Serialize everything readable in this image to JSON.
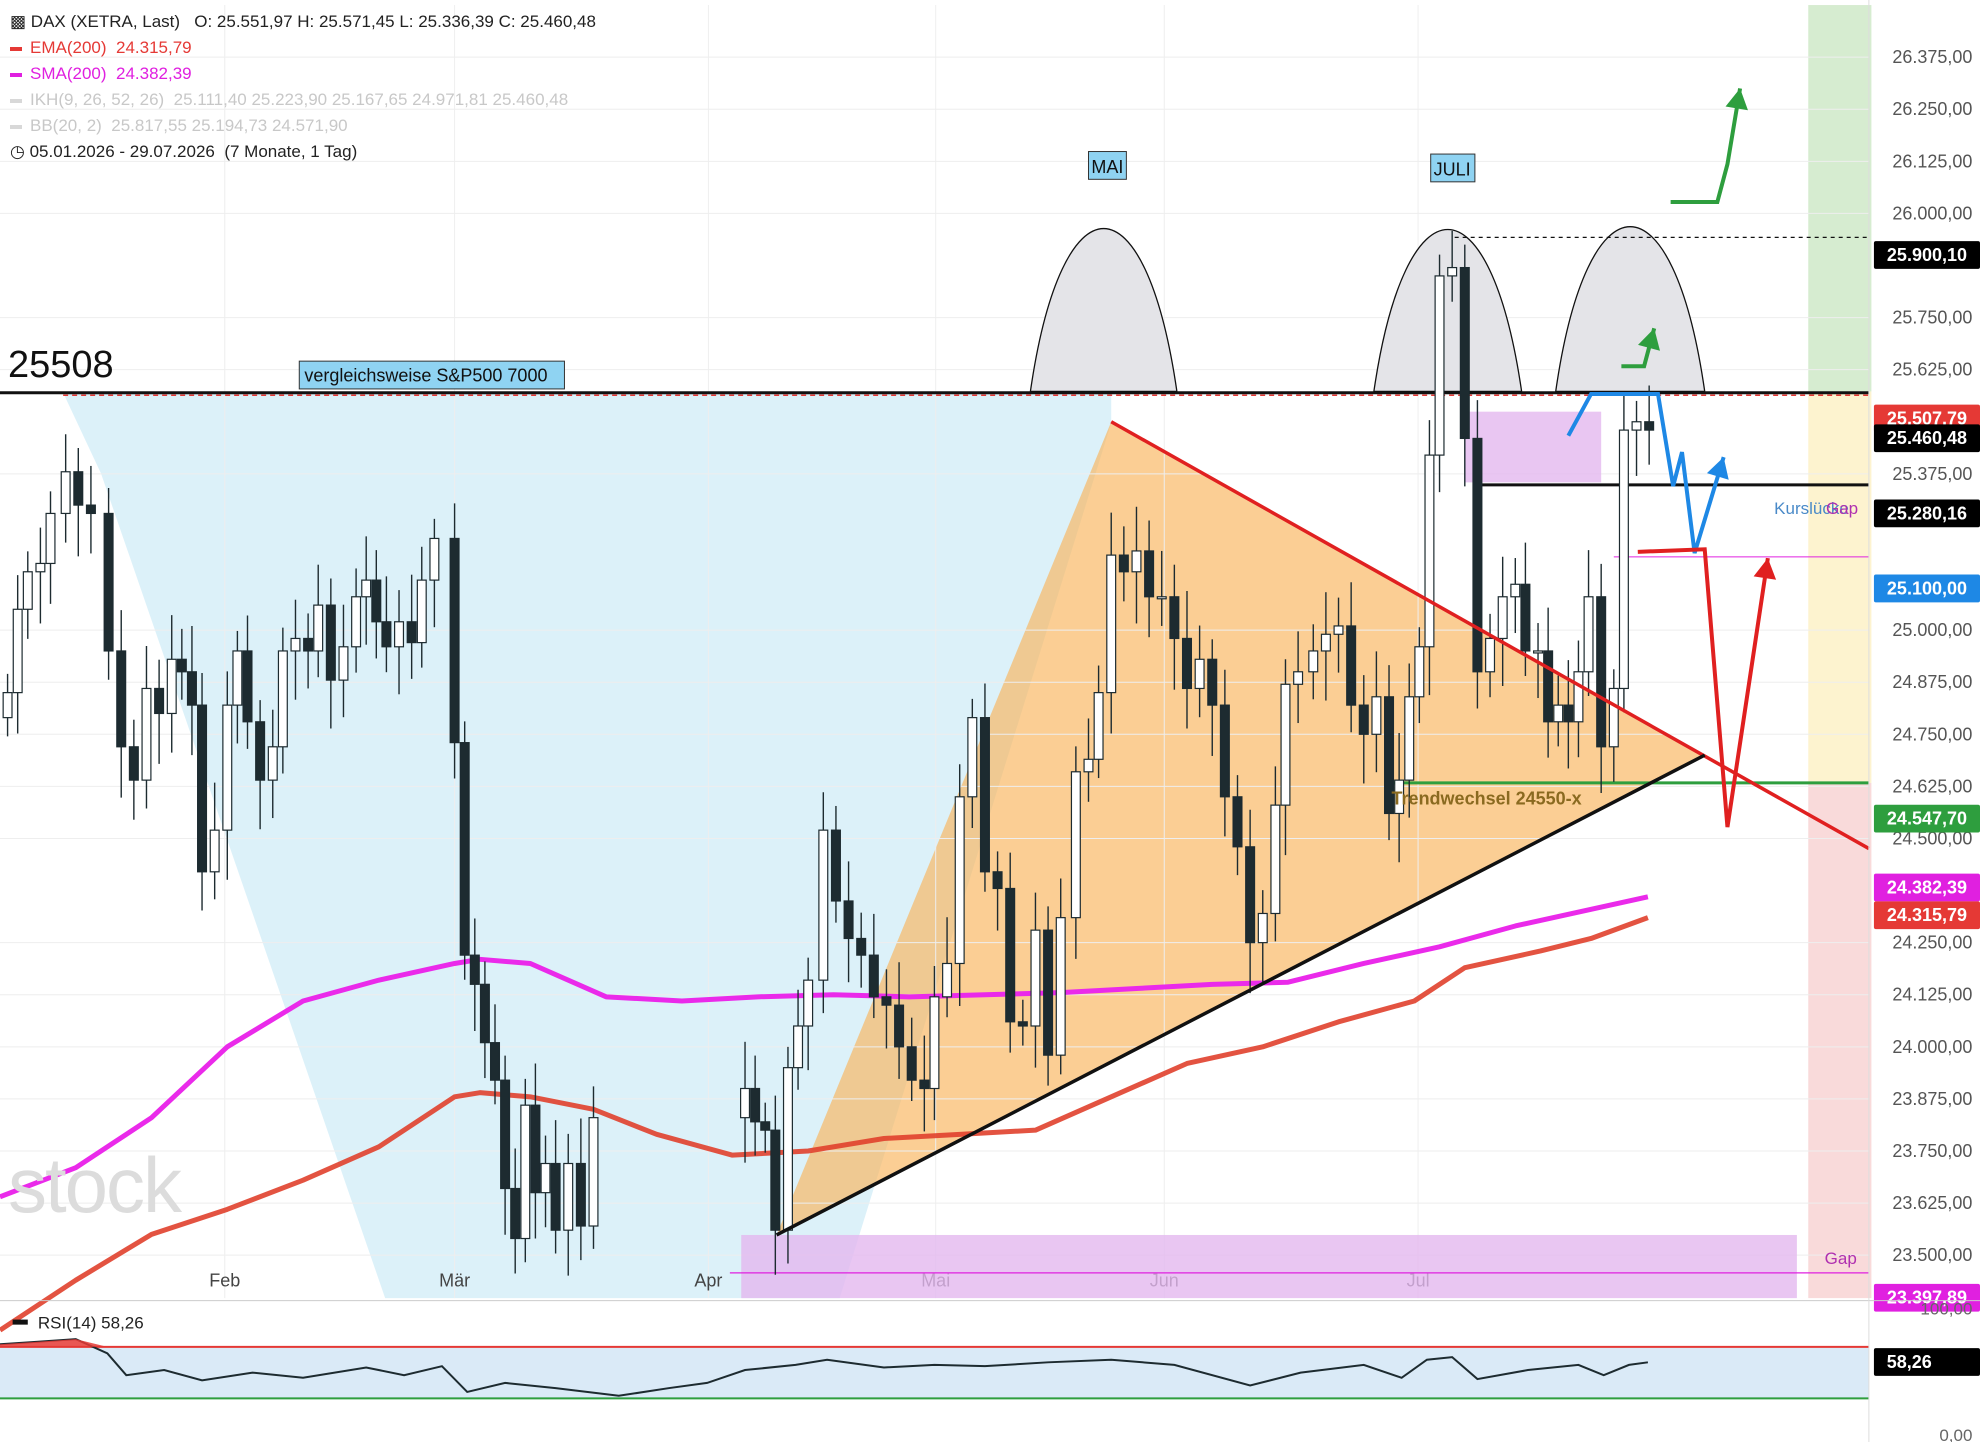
{
  "header": {
    "instrument": "DAX (XETRA, Last)",
    "ohlc": "O: 25.551,97   H: 25.571,45   L: 25.336,39   C: 25.460,48",
    "ema": {
      "label": "EMA(200)",
      "value": "24.315,79",
      "color": "#e53935"
    },
    "sma": {
      "label": "SMA(200)",
      "value": "24.382,39",
      "color": "#e020e0"
    },
    "ikh": {
      "label": "IKH(9, 26, 52, 26)",
      "values": "25.111,40   25.223,90   25.167,65   24.971,81   25.460,48"
    },
    "bb": {
      "label": "BB(20, 2)",
      "values": "25.817,55   25.194,73   24.571,90"
    },
    "range": "05.01.2026 - 29.07.2026",
    "range_note": "(7 Monate, 1 Tag)"
  },
  "level_text": "25508",
  "watermark": "stock",
  "chart_data": {
    "type": "candlestick",
    "y_axis": {
      "min": 23300,
      "max": 26500,
      "ticks": [
        "26.375,00",
        "26.250,00",
        "26.125,00",
        "26.000,00",
        "25.750,00",
        "25.625,00",
        "25.375,00",
        "25.000,00",
        "24.875,00",
        "24.750,00",
        "24.625,00",
        "24.500,00",
        "24.250,00",
        "24.125,00",
        "24.000,00",
        "23.875,00",
        "23.750,00",
        "23.625,00",
        "23.500,00"
      ],
      "tick_values": [
        26375,
        26250,
        26125,
        26000,
        25750,
        25625,
        25375,
        25000,
        24875,
        24750,
        24625,
        24500,
        24250,
        24125,
        24000,
        23875,
        23750,
        23625,
        23500
      ]
    },
    "x_axis": {
      "labels": [
        "Feb",
        "Mär",
        "Apr",
        "Mai",
        "Jun",
        "Jul"
      ]
    },
    "price_labels": [
      {
        "text": "25.900,10",
        "value": 25900.1,
        "bg": "#000000",
        "fg": "#ffffff"
      },
      {
        "text": "25.507,79",
        "value": 25507.79,
        "bg": "#e53935",
        "fg": "#ffffff"
      },
      {
        "text": "25.460,48",
        "value": 25460.48,
        "bg": "#000000",
        "fg": "#ffffff"
      },
      {
        "text": "25.280,16",
        "value": 25280.16,
        "bg": "#000000",
        "fg": "#ffffff"
      },
      {
        "text": "25.100,00",
        "value": 25100,
        "bg": "#1e88e5",
        "fg": "#ffffff"
      },
      {
        "text": "24.547,70",
        "value": 24547.7,
        "bg": "#2e9e3e",
        "fg": "#ffffff"
      },
      {
        "text": "24.382,39",
        "value": 24382.39,
        "bg": "#e020e0",
        "fg": "#ffffff"
      },
      {
        "text": "24.315,79",
        "value": 24315.79,
        "bg": "#e53935",
        "fg": "#ffffff"
      },
      {
        "text": "23.397,89",
        "value": 23397.89,
        "bg": "#e020e0",
        "fg": "#ffffff"
      }
    ],
    "annotations": {
      "sp500": "vergleichsweise S&P500 7000",
      "trend": "Trendwechsel 24550-x",
      "may_label": "MAI",
      "july_label": "JULI",
      "kurslucke": "Kurslücke",
      "gap": "Gap",
      "gap2": "Gap"
    },
    "sma200": [
      [
        0,
        23640
      ],
      [
        60,
        23710
      ],
      [
        120,
        23830
      ],
      [
        180,
        24000
      ],
      [
        240,
        24110
      ],
      [
        300,
        24160
      ],
      [
        360,
        24200
      ],
      [
        380,
        24210
      ],
      [
        420,
        24200
      ],
      [
        480,
        24120
      ],
      [
        540,
        24110
      ],
      [
        600,
        24120
      ],
      [
        660,
        24125
      ],
      [
        720,
        24120
      ],
      [
        780,
        24125
      ],
      [
        840,
        24130
      ],
      [
        900,
        24140
      ],
      [
        960,
        24150
      ],
      [
        1020,
        24155
      ],
      [
        1080,
        24200
      ],
      [
        1140,
        24240
      ],
      [
        1200,
        24290
      ],
      [
        1260,
        24330
      ],
      [
        1305,
        24360
      ]
    ],
    "ema200": [
      [
        0,
        23320
      ],
      [
        60,
        23440
      ],
      [
        120,
        23550
      ],
      [
        180,
        23610
      ],
      [
        240,
        23680
      ],
      [
        300,
        23760
      ],
      [
        360,
        23880
      ],
      [
        380,
        23890
      ],
      [
        420,
        23880
      ],
      [
        470,
        23850
      ],
      [
        520,
        23790
      ],
      [
        580,
        23740
      ],
      [
        640,
        23750
      ],
      [
        700,
        23780
      ],
      [
        760,
        23790
      ],
      [
        820,
        23800
      ],
      [
        880,
        23880
      ],
      [
        940,
        23960
      ],
      [
        1000,
        24000
      ],
      [
        1060,
        24060
      ],
      [
        1120,
        24110
      ],
      [
        1160,
        24190
      ],
      [
        1220,
        24230
      ],
      [
        1260,
        24260
      ],
      [
        1305,
        24310
      ]
    ],
    "rsi": {
      "label": "RSI(14)",
      "value": "58,26",
      "ticks": [
        "100,00",
        "0,00"
      ],
      "values": [
        [
          0,
          72
        ],
        [
          30,
          74
        ],
        [
          60,
          76
        ],
        [
          85,
          65
        ],
        [
          100,
          48
        ],
        [
          130,
          52
        ],
        [
          160,
          44
        ],
        [
          200,
          50
        ],
        [
          240,
          46
        ],
        [
          290,
          54
        ],
        [
          320,
          48
        ],
        [
          350,
          55
        ],
        [
          370,
          35
        ],
        [
          400,
          42
        ],
        [
          440,
          38
        ],
        [
          490,
          32
        ],
        [
          530,
          38
        ],
        [
          560,
          42
        ],
        [
          590,
          52
        ],
        [
          630,
          56
        ],
        [
          655,
          60
        ],
        [
          700,
          54
        ],
        [
          740,
          56
        ],
        [
          780,
          55
        ],
        [
          830,
          58
        ],
        [
          880,
          60
        ],
        [
          930,
          56
        ],
        [
          990,
          40
        ],
        [
          1030,
          50
        ],
        [
          1080,
          56
        ],
        [
          1110,
          46
        ],
        [
          1130,
          60
        ],
        [
          1150,
          62
        ],
        [
          1170,
          45
        ],
        [
          1210,
          52
        ],
        [
          1250,
          56
        ],
        [
          1270,
          48
        ],
        [
          1290,
          56
        ],
        [
          1305,
          58
        ]
      ],
      "upper": 70,
      "lower": 30
    }
  }
}
